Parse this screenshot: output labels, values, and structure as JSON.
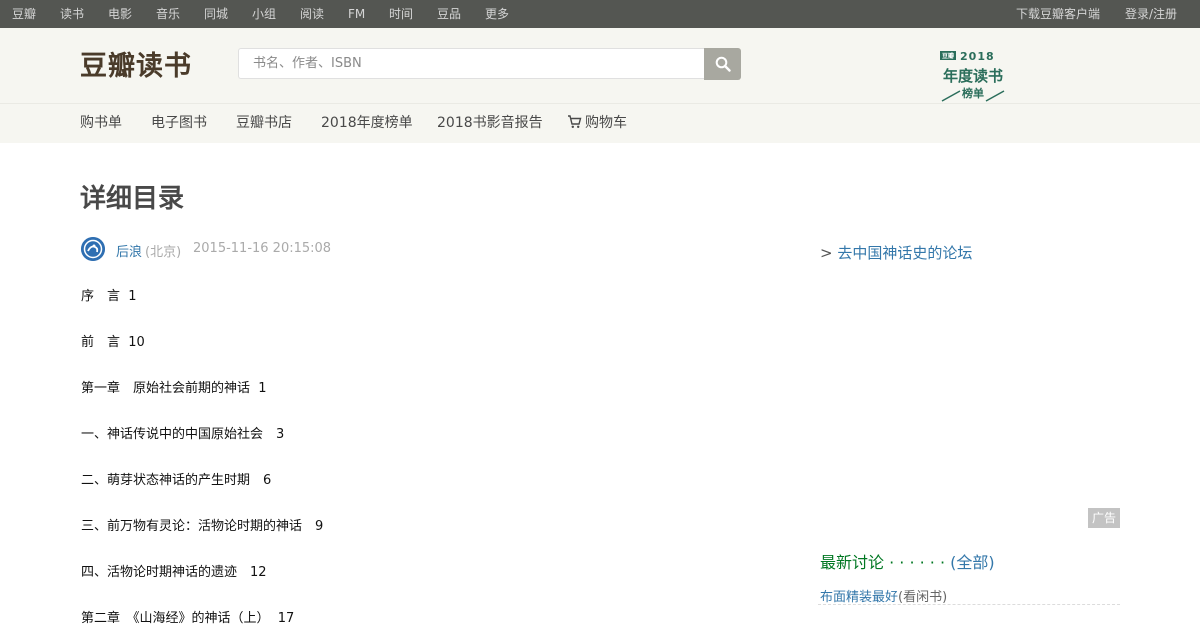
{
  "topbar": {
    "left_items": [
      "豆瓣",
      "读书",
      "电影",
      "音乐",
      "同城",
      "小组",
      "阅读",
      "FM",
      "时间",
      "豆品",
      "更多"
    ],
    "download_app": "下载豆瓣客户端",
    "login": "登录/注册"
  },
  "header": {
    "logo": "豆瓣读书",
    "search_placeholder": "书名、作者、ISBN",
    "search_icon": "search-icon",
    "year_badge": {
      "tag": "豆瓣",
      "year": "2018",
      "title": "年度读书",
      "subtitle": "榜单"
    }
  },
  "subnav": {
    "items": [
      "购书单",
      "电子图书",
      "豆瓣书店",
      "2018年度榜单",
      "2018书影音报告"
    ],
    "cart_icon": "cart-icon",
    "cart": "购物车"
  },
  "main": {
    "title": "详细目录",
    "author": "后浪",
    "location": "(北京)",
    "timestamp": "2015-11-16 20:15:08",
    "toc": [
      "序　言  1",
      "前　言  10",
      "第一章　原始社会前期的神话  1",
      "一、神话传说中的中国原始社会　3",
      "二、萌芽状态神话的产生时期　6",
      "三、前万物有灵论：活物论时期的神话　9",
      "四、活物论时期神话的遗迹　12",
      "第二章　《山海经》的神话（上）  17"
    ]
  },
  "sidebar": {
    "forum_arrow": ">",
    "forum_link": "去中国神话史的论坛",
    "ad_label": "广告",
    "discussion_title": "最新讨论",
    "discussion_dots": "· · · · · ·",
    "discussion_all": "(全部)",
    "discussions": [
      {
        "title": "布面精装最好",
        "author": "(看闲书)"
      }
    ]
  },
  "colors": {
    "topbar_bg": "#545652",
    "header_bg": "#f6f6f1",
    "link": "#3377aa",
    "green": "#007722",
    "badge_green": "#2b6e5b"
  }
}
